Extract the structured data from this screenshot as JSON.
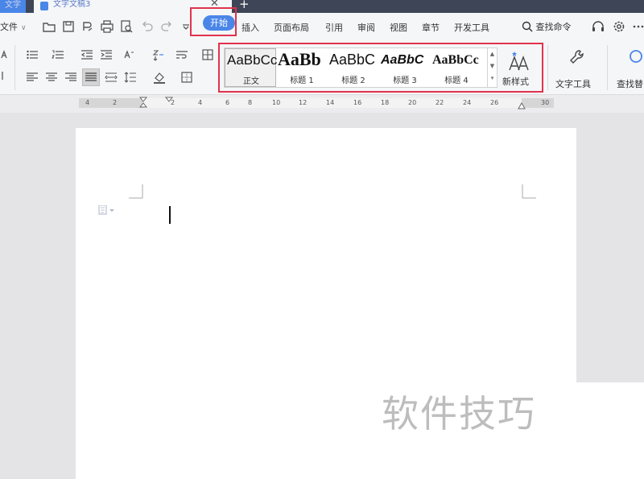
{
  "titlebar": {
    "app_label": "文字",
    "doc_title": "文字文稿3",
    "close_glyph": "✕",
    "new_tab_glyph": "+"
  },
  "menu": {
    "file_label": "文件",
    "tabs": [
      "开始",
      "插入",
      "页面布局",
      "引用",
      "审阅",
      "视图",
      "章节",
      "开发工具"
    ],
    "active_tab": "开始",
    "search_label": "查找命令"
  },
  "ribbon": {
    "styles": [
      {
        "sample": "AaBbCcD",
        "label": "正文",
        "selected": true
      },
      {
        "sample": "AaBb",
        "label": "标题 1",
        "selected": false
      },
      {
        "sample": "AaBbC",
        "label": "标题 2",
        "selected": false
      },
      {
        "sample": "AaBbC",
        "label": "标题 3",
        "selected": false
      },
      {
        "sample": "AaBbCc",
        "label": "标题 4",
        "selected": false
      }
    ],
    "new_style_label": "新样式",
    "text_tools_label": "文字工具",
    "find_replace_label": "查找替"
  },
  "ruler": {
    "labels": [
      "4",
      "2",
      "2",
      "4",
      "6",
      "8",
      "10",
      "12",
      "14",
      "16",
      "18",
      "20",
      "22",
      "24",
      "26",
      "30"
    ]
  },
  "watermark": "软件技巧",
  "colors": {
    "accent": "#4a86e8",
    "highlight_border": "#e0334d",
    "titlebar": "#3e4556"
  }
}
